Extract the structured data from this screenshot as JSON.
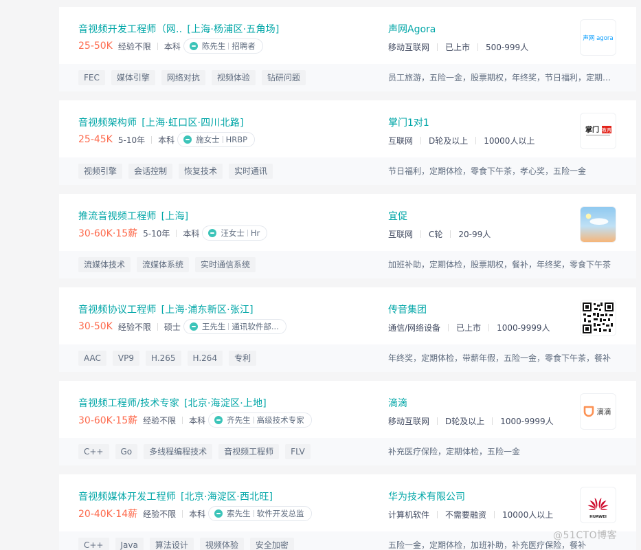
{
  "jobs": [
    {
      "title": "音视频开发工程师（网..",
      "location": "[上海·杨浦区·五角场]",
      "salary": "25-50K",
      "req": [
        "经验不限",
        "本科"
      ],
      "recruiter_name": "陈先生",
      "recruiter_role": "招聘者",
      "company": "声网Agora",
      "company_info": [
        "移动互联网",
        "已上市",
        "500-999人"
      ],
      "tags": [
        "FEC",
        "媒体引擎",
        "网络对抗",
        "视频体验",
        "钻研问题"
      ],
      "welfare": "员工旅游，五险一金，股票期权，年终奖，节日福利，定期体检",
      "logo": {
        "icon": "agora-logo",
        "text": "声网 agora"
      }
    },
    {
      "title": "音视频架构师",
      "location": "[上海·虹口区·四川北路]",
      "salary": "25-45K",
      "req": [
        "5-10年",
        "本科"
      ],
      "recruiter_name": "施女士",
      "recruiter_role": "HRBP",
      "company": "掌门1对1",
      "company_info": [
        "互联网",
        "D轮及以上",
        "10000人以上"
      ],
      "tags": [
        "视频引擎",
        "会话控制",
        "恢复技术",
        "实时通讯"
      ],
      "welfare": "节日福利，定期体检，零食下午茶，孝心奖，五险一金",
      "logo": {
        "icon": "zhangmen-logo",
        "text": "掌门",
        "badge": "教育"
      }
    },
    {
      "title": "推流音视频工程师",
      "location": "[上海]",
      "salary": "30-60K·15薪",
      "req": [
        "5-10年",
        "本科"
      ],
      "recruiter_name": "汪女士",
      "recruiter_role": "Hr",
      "company": "宜促",
      "company_info": [
        "互联网",
        "C轮",
        "20-99人"
      ],
      "tags": [
        "流媒体技术",
        "流媒体系统",
        "实时通信系统"
      ],
      "welfare": "加班补助，定期体检，股票期权，餐补，年终奖，零食下午茶",
      "logo": {
        "icon": "sky-logo",
        "text": ""
      }
    },
    {
      "title": "音视频协议工程师",
      "location": "[上海·浦东新区·张江]",
      "salary": "30-50K",
      "req": [
        "经验不限",
        "硕士"
      ],
      "recruiter_name": "王先生",
      "recruiter_role": "通讯软件部...",
      "company": "传音集团",
      "company_info": [
        "通信/网络设备",
        "已上市",
        "1000-9999人"
      ],
      "tags": [
        "AAC",
        "VP9",
        "H.265",
        "H.264",
        "专利"
      ],
      "welfare": "年终奖，定期体检，带薪年假，五险一金，零食下午茶，餐补",
      "logo": {
        "icon": "qr-code-logo",
        "text": ""
      }
    },
    {
      "title": "音视频工程师/技术专家",
      "location": "[北京·海淀区·上地]",
      "salary": "30-60K·15薪",
      "req": [
        "经验不限",
        "本科"
      ],
      "recruiter_name": "齐先生",
      "recruiter_role": "高级技术专家",
      "company": "滴滴",
      "company_info": [
        "移动互联网",
        "D轮及以上",
        "1000-9999人"
      ],
      "tags": [
        "C++",
        "Go",
        "多线程编程技术",
        "音视频工程师",
        "FLV"
      ],
      "welfare": "补充医疗保险，定期体检，五险一金",
      "logo": {
        "icon": "didi-logo",
        "text": "滴滴"
      }
    },
    {
      "title": "音视频媒体开发工程师",
      "location": "[北京·海淀区·西北旺]",
      "salary": "20-40K·14薪",
      "req": [
        "经验不限",
        "本科"
      ],
      "recruiter_name": "索先生",
      "recruiter_role": "软件开发总监",
      "company": "华为技术有限公司",
      "company_info": [
        "计算机软件",
        "不需要融资",
        "10000人以上"
      ],
      "tags": [
        "C++",
        "Java",
        "算法设计",
        "视频体验",
        "安全加密"
      ],
      "welfare": "五险一金，定期体检，加班补助，补充医疗保险，餐补",
      "logo": {
        "icon": "huawei-logo",
        "text": "HUAWEI"
      }
    }
  ],
  "watermark": "@51CTO博客",
  "colors": {
    "accent": "#00a6a7",
    "salary": "#fd6b4e",
    "background": "#f5f5f6"
  }
}
